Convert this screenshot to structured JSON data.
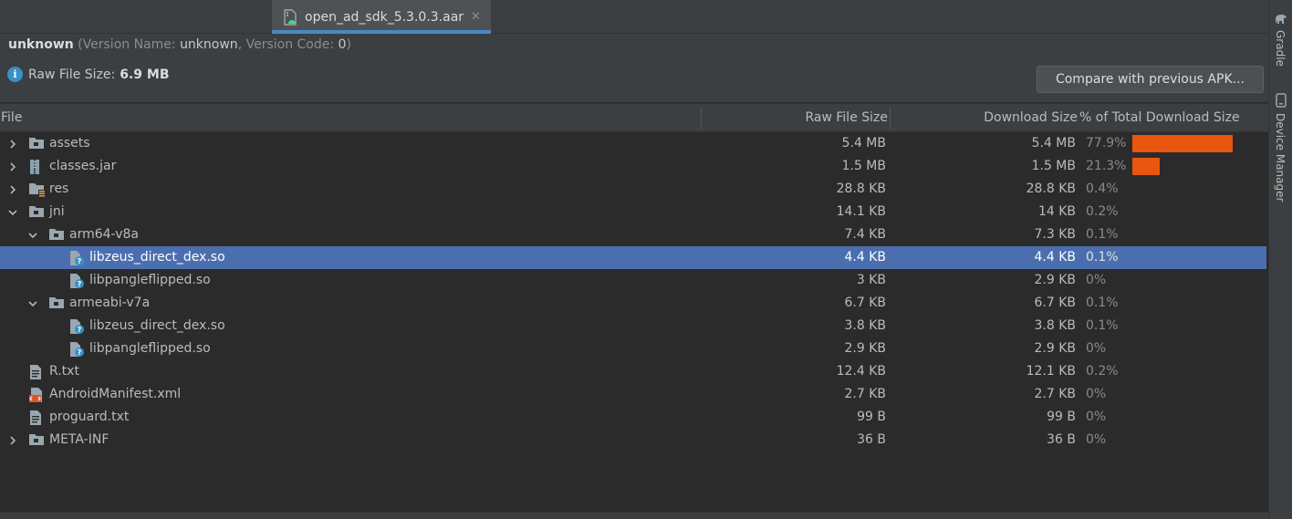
{
  "tab": {
    "label": "open_ad_sdk_5.3.0.3.aar",
    "close": "✕",
    "icon": "android-archive-icon"
  },
  "header": {
    "app_name": "unknown",
    "version_prefix": " (Version Name: ",
    "version_name": "unknown",
    "version_code_prefix": ", Version Code: ",
    "version_code": "0",
    "version_suffix": ")",
    "raw_size_label": "Raw File Size:",
    "raw_size_value": "6.9 MB",
    "compare_button": "Compare with previous APK..."
  },
  "columns": {
    "file": "File",
    "raw": "Raw File Size",
    "download": "Download Size",
    "percent": "% of Total Download Size"
  },
  "rows": [
    {
      "name": "assets",
      "raw": "5.4 MB",
      "download": "5.4 MB",
      "percent": "77.9%",
      "bar": 0.779,
      "icon": "folder-icon",
      "expand": "collapsed"
    },
    {
      "name": "classes.jar",
      "raw": "1.5 MB",
      "download": "1.5 MB",
      "percent": "21.3%",
      "bar": 0.213,
      "icon": "jar-icon",
      "expand": "collapsed"
    },
    {
      "name": "res",
      "raw": "28.8 KB",
      "download": "28.8 KB",
      "percent": "0.4%",
      "bar": 0,
      "icon": "resource-folder-icon",
      "expand": "collapsed"
    },
    {
      "name": "jni",
      "raw": "14.1 KB",
      "download": "14 KB",
      "percent": "0.2%",
      "bar": 0,
      "icon": "folder-icon",
      "expand": "expanded"
    },
    {
      "name": "arm64-v8a",
      "raw": "7.4 KB",
      "download": "7.3 KB",
      "percent": "0.1%",
      "bar": 0,
      "icon": "folder-icon",
      "expand": "expanded"
    },
    {
      "name": "libzeus_direct_dex.so",
      "raw": "4.4 KB",
      "download": "4.4 KB",
      "percent": "0.1%",
      "bar": 0,
      "icon": "unknown-file-icon",
      "expand": "none",
      "selected": true
    },
    {
      "name": "libpangleflipped.so",
      "raw": "3 KB",
      "download": "2.9 KB",
      "percent": "0%",
      "bar": 0,
      "icon": "unknown-file-icon",
      "expand": "none"
    },
    {
      "name": "armeabi-v7a",
      "raw": "6.7 KB",
      "download": "6.7 KB",
      "percent": "0.1%",
      "bar": 0,
      "icon": "folder-icon",
      "expand": "expanded"
    },
    {
      "name": "libzeus_direct_dex.so",
      "raw": "3.8 KB",
      "download": "3.8 KB",
      "percent": "0.1%",
      "bar": 0,
      "icon": "unknown-file-icon",
      "expand": "none"
    },
    {
      "name": "libpangleflipped.so",
      "raw": "2.9 KB",
      "download": "2.9 KB",
      "percent": "0%",
      "bar": 0,
      "icon": "unknown-file-icon",
      "expand": "none"
    },
    {
      "name": "R.txt",
      "raw": "12.4 KB",
      "download": "12.1 KB",
      "percent": "0.2%",
      "bar": 0,
      "icon": "text-file-icon",
      "expand": "none"
    },
    {
      "name": "AndroidManifest.xml",
      "raw": "2.7 KB",
      "download": "2.7 KB",
      "percent": "0%",
      "bar": 0,
      "icon": "xml-file-icon",
      "expand": "none"
    },
    {
      "name": "proguard.txt",
      "raw": "99 B",
      "download": "99 B",
      "percent": "0%",
      "bar": 0,
      "icon": "text-file-icon",
      "expand": "none"
    },
    {
      "name": "META-INF",
      "raw": "36 B",
      "download": "36 B",
      "percent": "0%",
      "bar": 0,
      "icon": "folder-icon",
      "expand": "collapsed"
    }
  ],
  "side_tools": {
    "gradle": "Gradle",
    "device_manager": "Device Manager"
  },
  "colors": {
    "selection": "#4b6eaf",
    "bar": "#e8560f",
    "tab_underline": "#4a88c7"
  }
}
